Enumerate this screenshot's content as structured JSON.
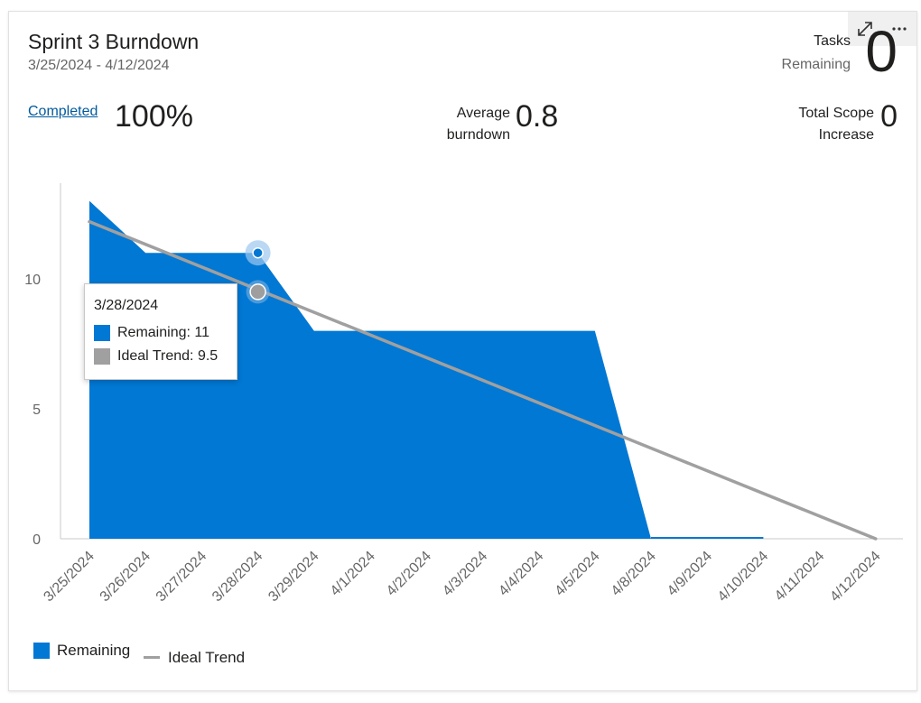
{
  "widget": {
    "title": "Sprint 3 Burndown",
    "date_range": "3/25/2024 - 4/12/2024",
    "tasks_label": "Tasks",
    "remaining_label": "Remaining",
    "tasks_remaining": "0",
    "completed_label": "Completed",
    "completed_value": "100%",
    "avg_label_1": "Average",
    "avg_label_2": "burndown",
    "avg_value": "0.8",
    "scope_label_1": "Total Scope",
    "scope_label_2": "Increase",
    "scope_value": "0",
    "expand_icon": "expand-icon",
    "more_icon": "more-icon"
  },
  "tooltip": {
    "date": "3/28/2024",
    "remaining": "Remaining: 11",
    "ideal": "Ideal Trend: 9.5"
  },
  "legend": {
    "remaining": "Remaining",
    "ideal": "Ideal Trend"
  },
  "colors": {
    "remaining": "#0078d4",
    "ideal": "#a0a0a0",
    "link": "#005a9e"
  },
  "chart_data": {
    "type": "area",
    "categories": [
      "3/25/2024",
      "3/26/2024",
      "3/27/2024",
      "3/28/2024",
      "3/29/2024",
      "4/1/2024",
      "4/2/2024",
      "4/3/2024",
      "4/4/2024",
      "4/5/2024",
      "4/8/2024",
      "4/9/2024",
      "4/10/2024",
      "4/11/2024",
      "4/12/2024"
    ],
    "series": [
      {
        "name": "Remaining",
        "type": "area",
        "values": [
          13,
          11,
          11,
          11,
          8,
          8,
          8,
          8,
          8,
          8,
          0,
          0,
          0,
          null,
          null
        ]
      },
      {
        "name": "Ideal Trend",
        "type": "line",
        "values": [
          12.2,
          11.3,
          10.4,
          9.5,
          8.7,
          7.8,
          7.0,
          6.1,
          5.2,
          4.4,
          3.5,
          2.6,
          1.7,
          0.9,
          0
        ]
      }
    ],
    "yticks": [
      0,
      5,
      10
    ],
    "ylim": [
      0,
      13.7
    ],
    "grid": false,
    "legend_position": "bottom-left",
    "highlighted_category": "3/28/2024"
  }
}
